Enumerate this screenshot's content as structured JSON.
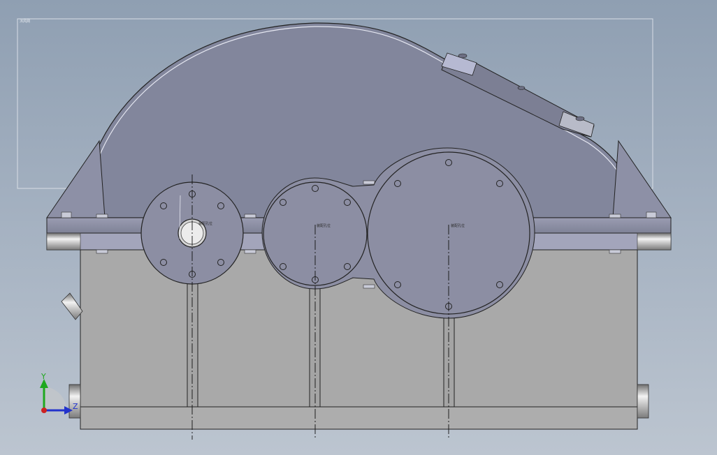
{
  "viewport": {
    "watermark_text": "沐风网",
    "triad": {
      "y_label": "Y",
      "z_label": "Z"
    }
  },
  "annotations": {
    "shaft1": "装配孔位",
    "shaft2": "装配孔位",
    "shaft3": "装配孔位"
  },
  "colors": {
    "background_top": "#8f9fb2",
    "background_bottom": "#bcc5d0",
    "cover": "#82869c",
    "housing": "#a9a9a9",
    "bearing_cap": "#8c8ea3",
    "axis_y": "#1fa81f",
    "axis_z": "#2233cc",
    "axis_x": "#cc2222"
  }
}
